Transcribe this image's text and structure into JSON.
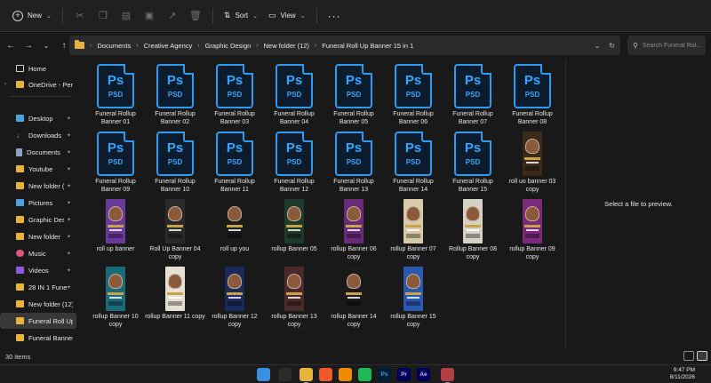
{
  "toolbar": {
    "new_label": "New",
    "sort_label": "Sort",
    "view_label": "View"
  },
  "address": {
    "crumbs": [
      "Documents",
      "Creative Agency",
      "Graphic Design",
      "New folder (12)",
      "Funeral Roll Up Banner 15 in 1"
    ]
  },
  "search": {
    "placeholder": "Search Funeral Rol..."
  },
  "sidebar": {
    "items": [
      {
        "label": "Home",
        "icon": "home-icon"
      },
      {
        "label": "OneDrive - Personal",
        "icon": "cloud-icon"
      },
      {
        "label": "Desktop",
        "icon": "desktop-icon"
      },
      {
        "label": "Downloads",
        "icon": "downloads-icon"
      },
      {
        "label": "Documents",
        "icon": "documents-icon"
      },
      {
        "label": "Youtube",
        "icon": "folder-icon"
      },
      {
        "label": "New folder (2)",
        "icon": "folder-icon"
      },
      {
        "label": "Pictures",
        "icon": "pictures-icon"
      },
      {
        "label": "Graphic Design",
        "icon": "folder-icon"
      },
      {
        "label": "New folder",
        "icon": "folder-icon"
      },
      {
        "label": "Music",
        "icon": "music-icon"
      },
      {
        "label": "Videos",
        "icon": "videos-icon"
      },
      {
        "label": "28 IN 1 Funeral",
        "icon": "folder-icon"
      },
      {
        "label": "New folder (12)",
        "icon": "folder-icon"
      },
      {
        "label": "Funeral Roll Up",
        "icon": "folder-icon"
      },
      {
        "label": "Funeral Banner",
        "icon": "folder-icon"
      }
    ]
  },
  "files": [
    {
      "name": "Funeral Rollup Banner 01",
      "type": "psd"
    },
    {
      "name": "Funeral Rollup Banner 02",
      "type": "psd"
    },
    {
      "name": "Funeral Rollup Banner 03",
      "type": "psd"
    },
    {
      "name": "Funeral Rollup Banner 04",
      "type": "psd"
    },
    {
      "name": "Funeral Rollup Banner 05",
      "type": "psd"
    },
    {
      "name": "Funeral Rollup Banner 06",
      "type": "psd"
    },
    {
      "name": "Funeral Rollup Banner 07",
      "type": "psd"
    },
    {
      "name": "Funeral Rollup Banner 08",
      "type": "psd"
    },
    {
      "name": "Funeral Rollup Banner 09",
      "type": "psd"
    },
    {
      "name": "Funeral Rollup Banner 10",
      "type": "psd"
    },
    {
      "name": "Funeral Rollup Banner 11",
      "type": "psd"
    },
    {
      "name": "Funeral Rollup Banner 12",
      "type": "psd"
    },
    {
      "name": "Funeral Rollup Banner 13",
      "type": "psd"
    },
    {
      "name": "Funeral Rollup Banner 14",
      "type": "psd"
    },
    {
      "name": "Funeral Rollup Banner 15",
      "type": "psd"
    },
    {
      "name": "roll uo banner 03 copy",
      "type": "image",
      "color": "#3a2a1a"
    },
    {
      "name": "roll up  banner",
      "type": "image",
      "color": "#6a3a9a"
    },
    {
      "name": "Roll Up Banner 04 copy",
      "type": "image",
      "color": "#2a2a2a"
    },
    {
      "name": "roll up you",
      "type": "image",
      "color": "#1a1a1a"
    },
    {
      "name": "rollup Banner 05",
      "type": "image",
      "color": "#1e3a2a"
    },
    {
      "name": "rollup Banner 06 copy",
      "type": "image",
      "color": "#6a2a7a"
    },
    {
      "name": "rollup Banner 07 copy",
      "type": "image",
      "color": "#d8c9a8"
    },
    {
      "name": "Rollup Banner 08 copy",
      "type": "image",
      "color": "#d6d0c6"
    },
    {
      "name": "rollup Banner 09 copy",
      "type": "image",
      "color": "#7a2a7a"
    },
    {
      "name": "rollup Banner 10 copy",
      "type": "image",
      "color": "#1a6a7a"
    },
    {
      "name": "rollup Banner 11 copy",
      "type": "image",
      "color": "#e6e0d4"
    },
    {
      "name": "rollup Banner 12 copy",
      "type": "image",
      "color": "#1a2a5a"
    },
    {
      "name": "rollup Banner 13 copy",
      "type": "image",
      "color": "#4a2a2a"
    },
    {
      "name": "rollup Banner 14 copy",
      "type": "image",
      "color": "#1a1a1a"
    },
    {
      "name": "rollup Banner 15 copy",
      "type": "image",
      "color": "#2a5ab0"
    }
  ],
  "preview": {
    "text": "Select a file to preview."
  },
  "status": {
    "item_count": "30 items"
  },
  "taskbar": {
    "apps": [
      {
        "name": "start-icon",
        "glyph": "",
        "color": "#3a8fe0"
      },
      {
        "name": "search-icon",
        "glyph": "",
        "color": "#2b2b2b"
      },
      {
        "name": "file-explorer-icon",
        "glyph": "",
        "color": "#e8b33c"
      },
      {
        "name": "brave-icon",
        "glyph": "",
        "color": "#f05a28"
      },
      {
        "name": "vlc-icon",
        "glyph": "",
        "color": "#f08a00"
      },
      {
        "name": "spotify-icon",
        "glyph": "",
        "color": "#1db954"
      },
      {
        "name": "photoshop-icon",
        "glyph": "Ps",
        "color": "#001e36"
      },
      {
        "name": "premiere-icon",
        "glyph": "Pr",
        "color": "#00005b"
      },
      {
        "name": "after-effects-icon",
        "glyph": "Ae",
        "color": "#00005b"
      },
      {
        "name": "app-icon",
        "glyph": "",
        "color": "#b04040"
      }
    ],
    "time": "9:47 PM",
    "date": "8/11/2026"
  }
}
